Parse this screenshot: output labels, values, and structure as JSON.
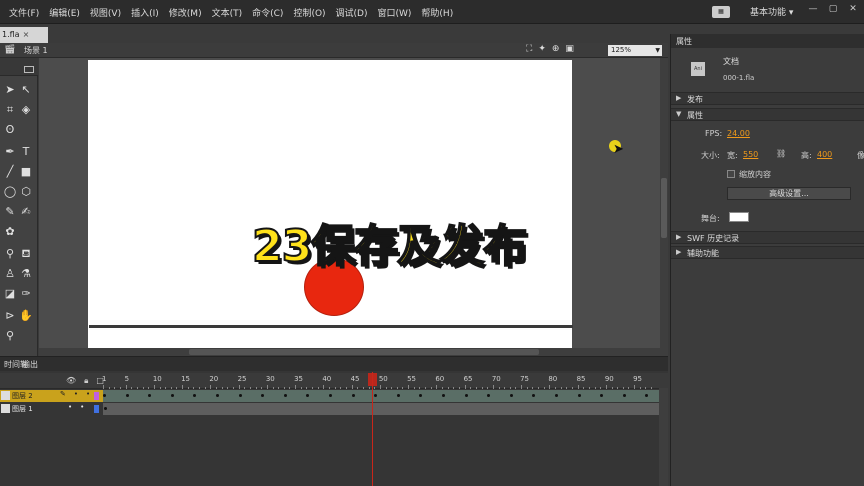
{
  "menu": {
    "items": [
      "文件(F)",
      "编辑(E)",
      "视图(V)",
      "插入(I)",
      "修改(M)",
      "文本(T)",
      "命令(C)",
      "控制(O)",
      "调试(D)",
      "窗口(W)",
      "帮助(H)"
    ],
    "workspace": "基本功能",
    "workspace_arrow": "▾",
    "badge_icon": "grid-badge-icon",
    "win_min": "—",
    "win_max": "▢",
    "win_close": "✕"
  },
  "document": {
    "tab_label": "1.fla",
    "tab_close": "×",
    "scene_label": "场景 1",
    "zoom": "125%"
  },
  "overlay": {
    "title": "23保存及发布"
  },
  "properties": {
    "tab": "属性",
    "doc_type": "文档",
    "doc_file": "000-1.fla",
    "doc_icon_label": "Ani",
    "sections": {
      "publish": "发布",
      "props": "属性",
      "swf_history": "SWF 历史记录",
      "accessibility": "辅助功能"
    },
    "fps_label": "FPS:",
    "fps_value": "24.00",
    "size_label": "大小:",
    "width_label": "宽:",
    "width_value": "550",
    "height_label": "高:",
    "height_value": "400",
    "unit_label": "像",
    "scale_content": "缩放内容",
    "advanced_button": "高级设置...",
    "stage_label": "舞台:",
    "stage_color": "#ffffff"
  },
  "timeline": {
    "tabs": [
      "时间轴",
      "输出"
    ],
    "ruler_labels": [
      "1",
      "5",
      "10",
      "15",
      "20",
      "25",
      "30",
      "35",
      "40",
      "45",
      "50",
      "55",
      "60",
      "65",
      "70",
      "75",
      "80",
      "85",
      "90",
      "95"
    ],
    "current_frame": 49,
    "layers": [
      {
        "name": "图层 2",
        "selected": true,
        "color": "#c060e0"
      },
      {
        "name": "图层 1",
        "selected": false,
        "color": "#4070e0"
      }
    ]
  },
  "colors": {
    "ball": "#e8270f",
    "caption": "#ffe21a",
    "accent_value": "#f09a1a",
    "selected_layer": "#c9a21c"
  }
}
